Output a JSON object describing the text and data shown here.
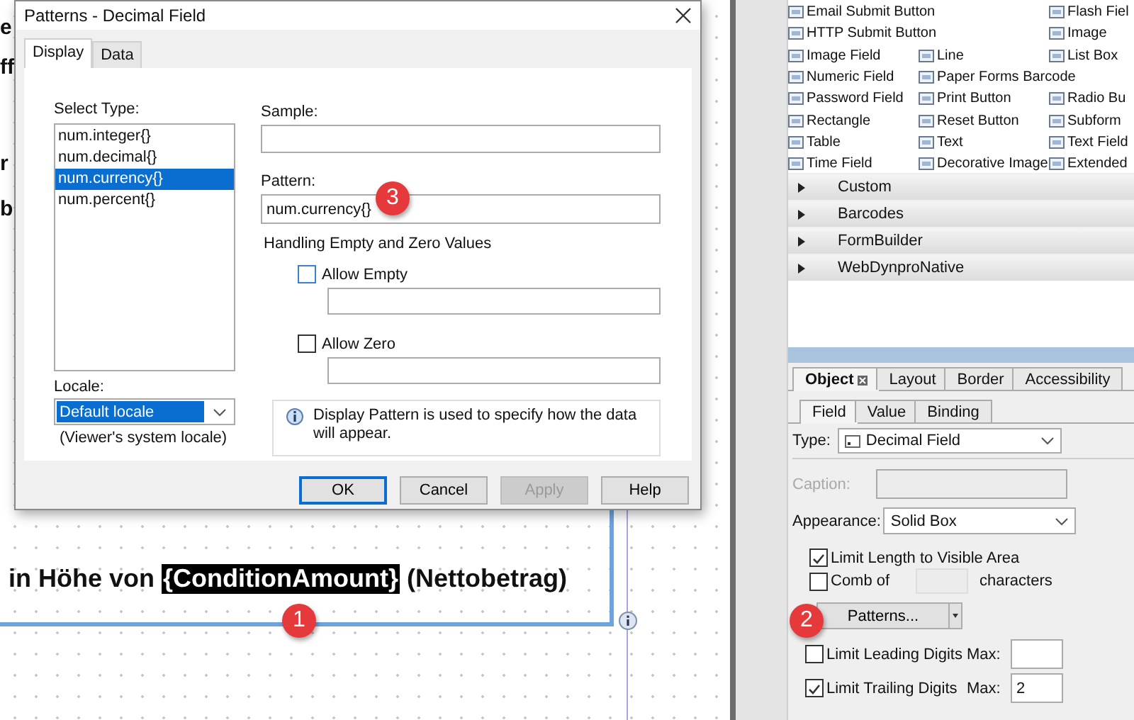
{
  "canvas": {
    "edge_letters": [
      "e",
      "ff",
      "r",
      "b"
    ],
    "sentence": {
      "before": "in Höhe von",
      "field": "{ConditionAmount}",
      "after": "(Nettobetrag)"
    },
    "badge": "1"
  },
  "dialog": {
    "title": "Patterns - Decimal Field",
    "tabs": [
      {
        "label": "Display",
        "selected": true
      },
      {
        "label": "Data",
        "selected": false
      }
    ],
    "select_type_label": "Select Type:",
    "types": [
      {
        "label": "num.integer{}",
        "selected": false
      },
      {
        "label": "num.decimal{}",
        "selected": false
      },
      {
        "label": "num.currency{}",
        "selected": true
      },
      {
        "label": "num.percent{}",
        "selected": false
      }
    ],
    "locale_label": "Locale:",
    "locale_value": "Default locale",
    "locale_note": "(Viewer's system locale)",
    "sample_label": "Sample:",
    "pattern_label": "Pattern:",
    "pattern_value": "num.currency{}",
    "badge": "3",
    "handling_title": "Handling Empty and Zero Values",
    "options": [
      {
        "label": "Allow Empty",
        "checked": false
      },
      {
        "label": "Allow Zero",
        "checked": false
      }
    ],
    "info_text": "Display Pattern is used to specify how the data will appear.",
    "buttons": [
      {
        "label": "OK",
        "kind": "default",
        "disabled": false
      },
      {
        "label": "Cancel",
        "kind": "normal",
        "disabled": false
      },
      {
        "label": "Apply",
        "kind": "normal",
        "disabled": true
      },
      {
        "label": "Help",
        "kind": "normal",
        "disabled": false
      }
    ]
  },
  "library": {
    "rows": [
      {
        "col_1": "Email Submit Button",
        "col_3": "Flash Fiel"
      },
      {
        "col_1": "HTTP Submit Button",
        "col_3": "Image"
      },
      {
        "col_1": "Image Field",
        "col_2": "Line",
        "col_3": "List Box"
      },
      {
        "col_1": "Numeric Field",
        "col_2": "Paper Forms Barcode"
      },
      {
        "col_1": "Password Field",
        "col_2": "Print Button",
        "col_3": "Radio Bu"
      },
      {
        "col_1": "Rectangle",
        "col_2": "Reset Button",
        "col_3": "Subform"
      },
      {
        "col_1": "Table",
        "col_2": "Text",
        "col_3": "Text Field"
      },
      {
        "col_1": "Time Field",
        "col_2": "Decorative Image",
        "col_3": "Extended"
      }
    ],
    "categories": [
      {
        "label": "Custom",
        "expanded": false
      },
      {
        "label": "Barcodes",
        "expanded": false
      },
      {
        "label": "FormBuilder",
        "expanded": false
      },
      {
        "label": "WebDynproNative",
        "expanded": false
      }
    ]
  },
  "object_panel": {
    "tabs": [
      {
        "label": "Object",
        "selected": true
      },
      {
        "label": "Layout",
        "selected": false
      },
      {
        "label": "Border",
        "selected": false
      },
      {
        "label": "Accessibility",
        "selected": false
      }
    ],
    "subtabs": [
      {
        "label": "Field",
        "selected": true
      },
      {
        "label": "Value",
        "selected": false
      },
      {
        "label": "Binding",
        "selected": false
      }
    ],
    "type": {
      "label": "Type:",
      "value": "Decimal Field"
    },
    "caption": {
      "label": "Caption:",
      "disabled": true
    },
    "appearance": {
      "label": "Appearance:",
      "value": "Solid Box"
    },
    "limit_length": {
      "label": "Limit Length to Visible Area",
      "checked": true
    },
    "comb": {
      "label": "Comb of",
      "checked": false,
      "suffix": "characters"
    },
    "patterns_button": "Patterns...",
    "badge": "2",
    "digits": [
      {
        "label": "Limit Leading Digits",
        "checked": false,
        "max_label": "Max:"
      },
      {
        "label": "Limit Trailing Digits",
        "checked": true,
        "max_label": "Max:",
        "max_value": "2"
      }
    ]
  }
}
